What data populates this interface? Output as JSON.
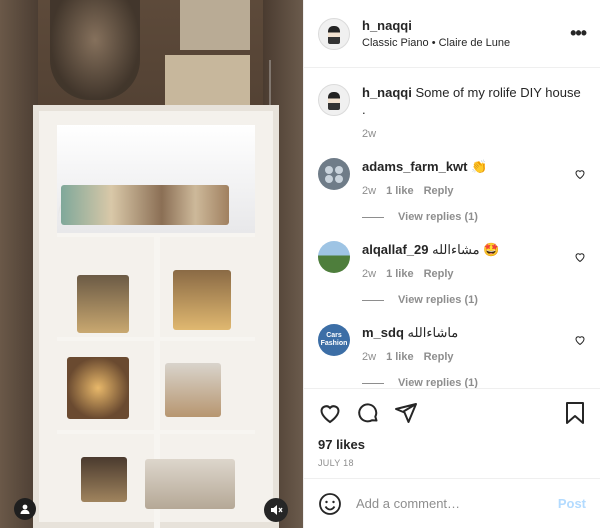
{
  "header": {
    "username": "h_naqqi",
    "subtitle": "Classic Piano • Claire de Lune",
    "more_label": "•••"
  },
  "caption": {
    "username": "h_naqqi",
    "text": "Some of my rolife DIY house .",
    "time": "2w"
  },
  "comments": [
    {
      "username": "adams_farm_kwt",
      "text": "👏",
      "time": "2w",
      "likes": "1 like",
      "reply": "Reply",
      "view_replies": "View replies (1)"
    },
    {
      "username": "alqallaf_29",
      "text": "مشاءالله 🤩",
      "time": "2w",
      "likes": "1 like",
      "reply": "Reply",
      "view_replies": "View replies (1)"
    },
    {
      "username": "m_sdq",
      "text": "ماشاءالله",
      "time": "2w",
      "likes": "1 like",
      "reply": "Reply",
      "view_replies": "View replies (1)",
      "avatar_text": "Cars Fashion"
    }
  ],
  "likes": "97 likes",
  "date": "JULY 18",
  "add_comment": {
    "placeholder": "Add a comment…",
    "post_label": "Post"
  },
  "icons": [
    "heart-icon",
    "comment-icon",
    "share-icon",
    "bookmark-icon",
    "emoji-icon",
    "user-tag-icon",
    "mute-icon",
    "more-icon"
  ],
  "colors": {
    "post_disabled": "#b3dbff",
    "muted_text": "#8e8e8e",
    "text": "#262626",
    "border": "#efefef"
  }
}
